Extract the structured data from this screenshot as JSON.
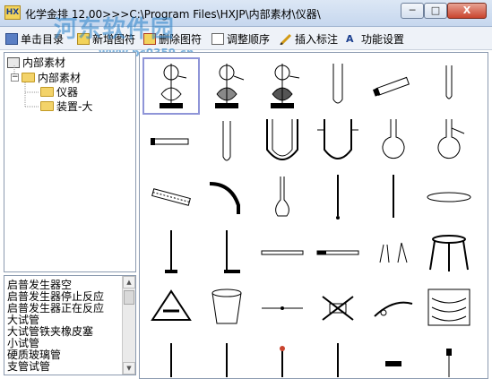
{
  "window": {
    "app_icon_text": "HX",
    "title": "化学金排 12.00>>>C:\\Program Files\\HXJP\\内部素材\\仪器\\",
    "min_label": "─",
    "max_label": "□",
    "close_label": "X"
  },
  "watermark": {
    "line1": "河东软件园",
    "line2": "www.pc0359.cn"
  },
  "toolbar": {
    "items": [
      {
        "label": "单击目录"
      },
      {
        "label": "新增图符"
      },
      {
        "label": "删除图符"
      },
      {
        "label": "调整顺序"
      },
      {
        "label": "插入标注"
      },
      {
        "label": "功能设置"
      }
    ]
  },
  "tree": {
    "root": "内部素材",
    "child": "内部素材",
    "leaves": [
      "仪器",
      "装置-大"
    ]
  },
  "names": [
    "启普发生器空",
    "启普发生器停止反应",
    "启普发生器正在反应",
    "大试管",
    "大试管铁夹橡皮塞",
    "小试管",
    "硬质玻璃管",
    "支管试管"
  ]
}
